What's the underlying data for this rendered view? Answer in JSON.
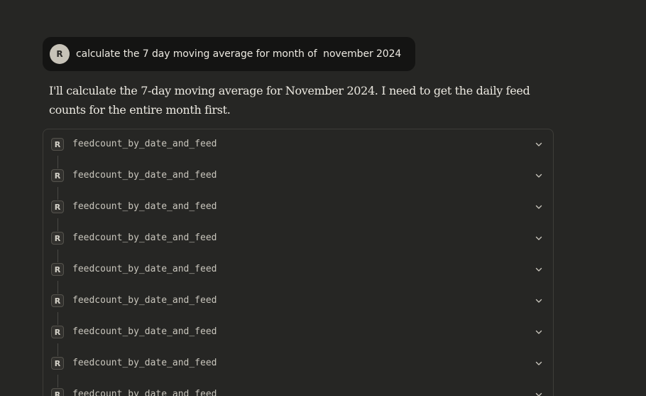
{
  "user_message": {
    "avatar_initial": "R",
    "text": "calculate the 7 day moving average for month of  november 2024"
  },
  "assistant_message": {
    "text": "I'll calculate the 7-day moving average for November 2024. I need to get the daily feed counts for the entire month first."
  },
  "tool_calls": [
    {
      "badge": "R",
      "label": "feedcount_by_date_and_feed",
      "icon": "chevron-down-icon"
    },
    {
      "badge": "R",
      "label": "feedcount_by_date_and_feed",
      "icon": "chevron-down-icon"
    },
    {
      "badge": "R",
      "label": "feedcount_by_date_and_feed",
      "icon": "chevron-down-icon"
    },
    {
      "badge": "R",
      "label": "feedcount_by_date_and_feed",
      "icon": "chevron-down-icon"
    },
    {
      "badge": "R",
      "label": "feedcount_by_date_and_feed",
      "icon": "chevron-down-icon"
    },
    {
      "badge": "R",
      "label": "feedcount_by_date_and_feed",
      "icon": "chevron-down-icon"
    },
    {
      "badge": "R",
      "label": "feedcount_by_date_and_feed",
      "icon": "chevron-down-icon"
    },
    {
      "badge": "R",
      "label": "feedcount_by_date_and_feed",
      "icon": "chevron-down-icon"
    },
    {
      "badge": "R",
      "label": "feedcount_by_date_and_feed",
      "icon": "chevron-down-icon"
    }
  ]
}
